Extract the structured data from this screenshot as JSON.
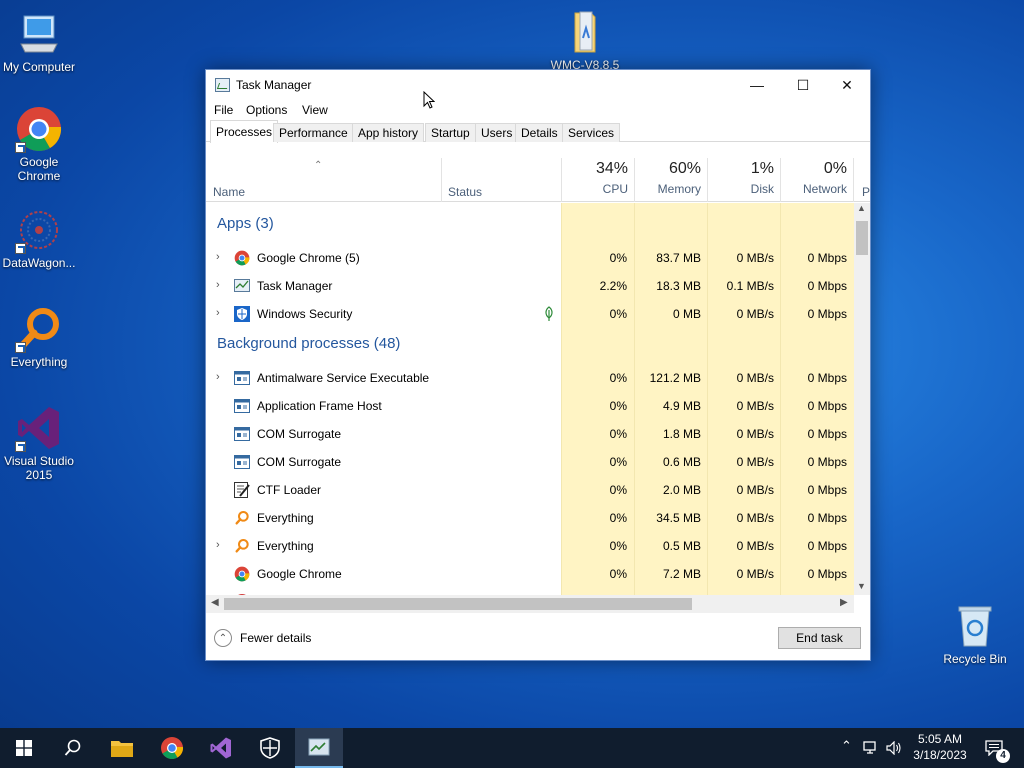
{
  "desktop": {
    "icons": [
      {
        "label": "My Computer",
        "icon": "computer-icon"
      },
      {
        "label": "Google Chrome",
        "icon": "chrome-icon"
      },
      {
        "label": "DataWagon...",
        "icon": "datawagon-icon"
      },
      {
        "label": "Everything",
        "icon": "everything-icon"
      },
      {
        "label": "Visual Studio 2015",
        "icon": "visual-studio-icon"
      },
      {
        "label": "WMC-V8.8.5",
        "icon": "folder-icon"
      },
      {
        "label": "Recycle Bin",
        "icon": "recycle-bin-icon"
      }
    ]
  },
  "window": {
    "title": "Task Manager",
    "controls": {
      "minimize": "—",
      "maximize": "☐",
      "close": "✕"
    },
    "menu": [
      "File",
      "Options",
      "View"
    ],
    "tabs": [
      "Processes",
      "Performance",
      "App history",
      "Startup",
      "Users",
      "Details",
      "Services"
    ],
    "active_tab": "Processes",
    "columns": {
      "name": "Name",
      "status": "Status",
      "cpu": {
        "pct": "34%",
        "label": "CPU"
      },
      "memory": {
        "pct": "60%",
        "label": "Memory"
      },
      "disk": {
        "pct": "1%",
        "label": "Disk"
      },
      "network": {
        "pct": "0%",
        "label": "Network"
      },
      "power": "P"
    },
    "groups": {
      "apps": "Apps (3)",
      "background": "Background processes (48)"
    },
    "apps": [
      {
        "name": "Google Chrome (5)",
        "icon": "chrome-icon",
        "cpu": "0%",
        "memory": "83.7 MB",
        "disk": "0 MB/s",
        "network": "0 Mbps",
        "expandable": true
      },
      {
        "name": "Task Manager",
        "icon": "task-manager-icon",
        "cpu": "2.2%",
        "memory": "18.3 MB",
        "disk": "0.1 MB/s",
        "network": "0 Mbps",
        "expandable": true
      },
      {
        "name": "Windows Security",
        "icon": "windows-security-icon",
        "cpu": "0%",
        "memory": "0 MB",
        "disk": "0 MB/s",
        "network": "0 Mbps",
        "expandable": true
      }
    ],
    "background": [
      {
        "name": "Antimalware Service Executable",
        "icon": "service-icon",
        "cpu": "0%",
        "memory": "121.2 MB",
        "disk": "0 MB/s",
        "network": "0 Mbps",
        "expandable": true
      },
      {
        "name": "Application Frame Host",
        "icon": "service-icon",
        "cpu": "0%",
        "memory": "4.9 MB",
        "disk": "0 MB/s",
        "network": "0 Mbps",
        "expandable": false
      },
      {
        "name": "COM Surrogate",
        "icon": "service-icon",
        "cpu": "0%",
        "memory": "1.8 MB",
        "disk": "0 MB/s",
        "network": "0 Mbps",
        "expandable": false
      },
      {
        "name": "COM Surrogate",
        "icon": "service-icon",
        "cpu": "0%",
        "memory": "0.6 MB",
        "disk": "0 MB/s",
        "network": "0 Mbps",
        "expandable": false
      },
      {
        "name": "CTF Loader",
        "icon": "ctf-loader-icon",
        "cpu": "0%",
        "memory": "2.0 MB",
        "disk": "0 MB/s",
        "network": "0 Mbps",
        "expandable": false
      },
      {
        "name": "Everything",
        "icon": "everything-icon",
        "cpu": "0%",
        "memory": "34.5 MB",
        "disk": "0 MB/s",
        "network": "0 Mbps",
        "expandable": false
      },
      {
        "name": "Everything",
        "icon": "everything-icon",
        "cpu": "0%",
        "memory": "0.5 MB",
        "disk": "0 MB/s",
        "network": "0 Mbps",
        "expandable": true
      },
      {
        "name": "Google Chrome",
        "icon": "chrome-icon",
        "cpu": "0%",
        "memory": "7.2 MB",
        "disk": "0 MB/s",
        "network": "0 Mbps",
        "expandable": false
      }
    ],
    "footer": {
      "fewer_details": "Fewer details",
      "end_task": "End task"
    }
  },
  "taskbar": {
    "items": [
      "start-icon",
      "search-icon",
      "file-explorer-icon",
      "chrome-icon",
      "visual-studio-icon",
      "windows-security-icon",
      "task-manager-icon"
    ],
    "time": "5:05 AM",
    "date": "3/18/2023",
    "notification_count": "4"
  },
  "colors": {
    "accent": "#0078d7",
    "heat_light": "#fff4c4",
    "heat_medium": "#fae8a0",
    "group_header": "#24579e",
    "taskbar": "#101d2e"
  }
}
